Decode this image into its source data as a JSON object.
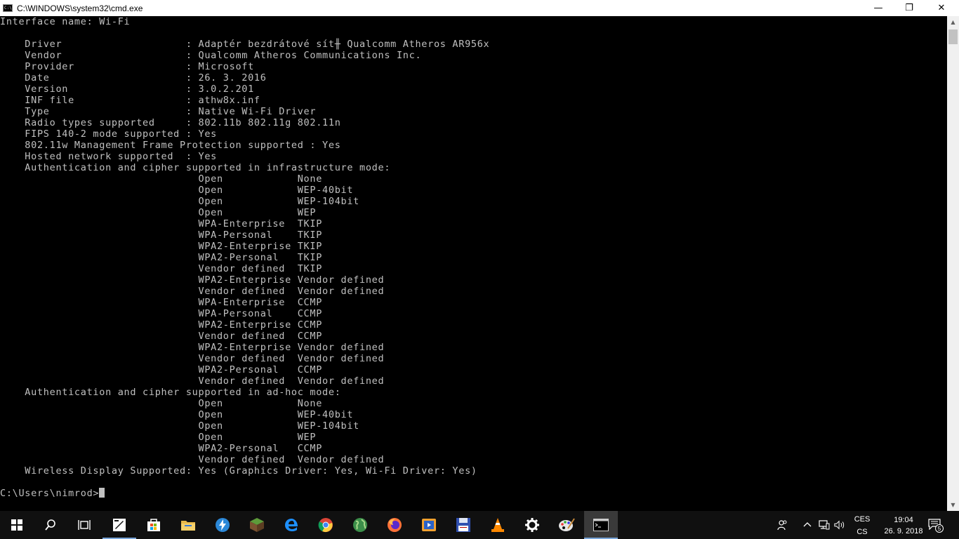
{
  "window": {
    "title": "C:\\WINDOWS\\system32\\cmd.exe",
    "app_icon_text": "C:\\",
    "minimize": "—",
    "maximize": "❐",
    "close": "✕"
  },
  "console": {
    "text": "Interface name: Wi-Fi\n\n    Driver                    : Adaptér bezdrátové sít╫ Qualcomm Atheros AR956x\n    Vendor                    : Qualcomm Atheros Communications Inc.\n    Provider                  : Microsoft\n    Date                      : 26. 3. 2016\n    Version                   : 3.0.2.201\n    INF file                  : athw8x.inf\n    Type                      : Native Wi-Fi Driver\n    Radio types supported     : 802.11b 802.11g 802.11n\n    FIPS 140-2 mode supported : Yes\n    802.11w Management Frame Protection supported : Yes\n    Hosted network supported  : Yes\n    Authentication and cipher supported in infrastructure mode:\n                                Open            None\n                                Open            WEP-40bit\n                                Open            WEP-104bit\n                                Open            WEP\n                                WPA-Enterprise  TKIP\n                                WPA-Personal    TKIP\n                                WPA2-Enterprise TKIP\n                                WPA2-Personal   TKIP\n                                Vendor defined  TKIP\n                                WPA2-Enterprise Vendor defined\n                                Vendor defined  Vendor defined\n                                WPA-Enterprise  CCMP\n                                WPA-Personal    CCMP\n                                WPA2-Enterprise CCMP\n                                Vendor defined  CCMP\n                                WPA2-Enterprise Vendor defined\n                                Vendor defined  Vendor defined\n                                WPA2-Personal   CCMP\n                                Vendor defined  Vendor defined\n    Authentication and cipher supported in ad-hoc mode:\n                                Open            None\n                                Open            WEP-40bit\n                                Open            WEP-104bit\n                                Open            WEP\n                                WPA2-Personal   CCMP\n                                Vendor defined  Vendor defined\n    Wireless Display Supported: Yes (Graphics Driver: Yes, Wi-Fi Driver: Yes)\n\n",
    "prompt": "C:\\Users\\nimrod>"
  },
  "taskbar": {
    "apps": [
      {
        "name": "start",
        "icon": "windows-logo-icon"
      },
      {
        "name": "search",
        "icon": "search-icon"
      },
      {
        "name": "task-view",
        "icon": "task-view-icon"
      },
      {
        "name": "photo-app",
        "icon": "image-editor-icon"
      },
      {
        "name": "store",
        "icon": "store-icon"
      },
      {
        "name": "file-explorer",
        "icon": "folder-icon"
      },
      {
        "name": "edge-dev",
        "icon": "lightning-icon"
      },
      {
        "name": "minecraft",
        "icon": "grass-block-icon"
      },
      {
        "name": "edge",
        "icon": "edge-icon"
      },
      {
        "name": "chrome",
        "icon": "chrome-icon"
      },
      {
        "name": "globe-app",
        "icon": "globe-icon"
      },
      {
        "name": "firefox",
        "icon": "firefox-icon"
      },
      {
        "name": "video-player",
        "icon": "video-icon"
      },
      {
        "name": "save-app",
        "icon": "floppy-disk-icon"
      },
      {
        "name": "vlc",
        "icon": "vlc-cone-icon"
      },
      {
        "name": "settings",
        "icon": "gear-icon"
      },
      {
        "name": "paint",
        "icon": "paint-palette-icon"
      },
      {
        "name": "cmd",
        "icon": "command-prompt-icon"
      }
    ],
    "tray": {
      "language_top": "CES",
      "language_bottom": "CS",
      "time": "19:04",
      "date": "26. 9. 2018",
      "notification_count": "5"
    }
  }
}
